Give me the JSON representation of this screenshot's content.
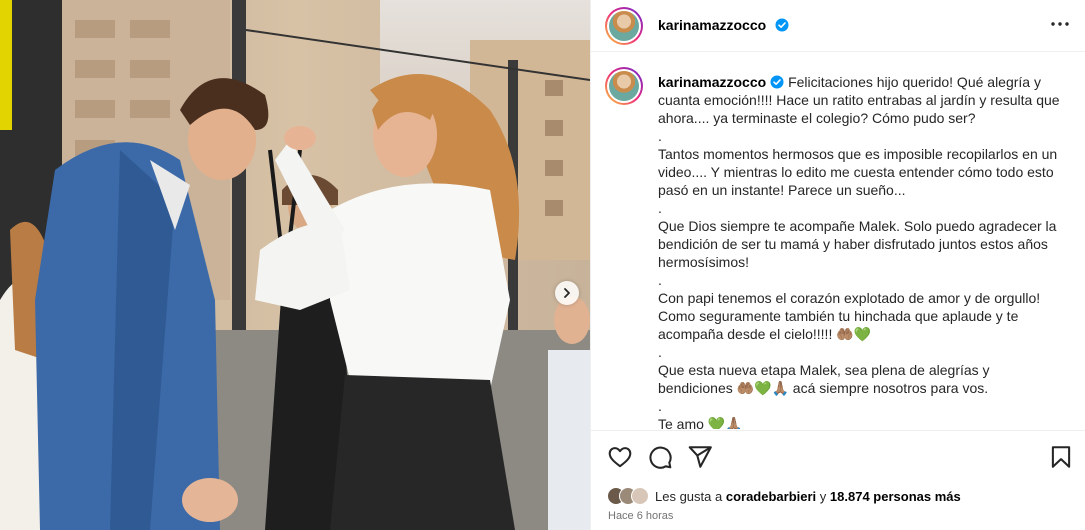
{
  "post": {
    "username": "karinamazzocco",
    "caption_lines": [
      "Felicitaciones hijo querido! Qué alegría y cuanta emoción!!!! Hace un ratito entrabas al jardín y resulta que ahora.... ya terminaste el colegio? Cómo pudo ser?",
      ".",
      "Tantos momentos hermosos que es imposible recopilarlos en un video.... Y mientras lo edito me cuesta entender cómo todo esto pasó en un instante! Parece un sueño...",
      ".",
      "Que Dios siempre te acompañe Malek. Solo puedo agradecer la bendición de ser tu mamá y haber disfrutado juntos estos años hermosísimos!",
      ".",
      "Con papi tenemos el corazón explotado de amor y de orgullo! Como seguramente también tu hinchada que aplaude y te acompaña desde el cielo!!!!! 🤲🏽💚",
      ".",
      "Que esta nueva etapa Malek, sea plena de alegrías y bendiciones 🤲🏽💚🙏🏽 acá siempre nosotros para vos.",
      ".",
      "Te amo 💚🙏🏽"
    ],
    "likes_prefix": "Les gusta a",
    "likes_user": "coradebarbieri",
    "likes_joiner": "y",
    "likes_count": "18.874 personas más",
    "time_ago": "Hace 6 horas"
  },
  "icons": {
    "verified": "verified-badge-icon",
    "more": "more-options-icon",
    "like": "heart-icon",
    "comment": "comment-icon",
    "share": "share-icon",
    "save": "bookmark-icon",
    "next": "chevron-right-icon"
  },
  "colors": {
    "verified": "#0095f6",
    "border": "#efefef",
    "muted": "#737373"
  }
}
